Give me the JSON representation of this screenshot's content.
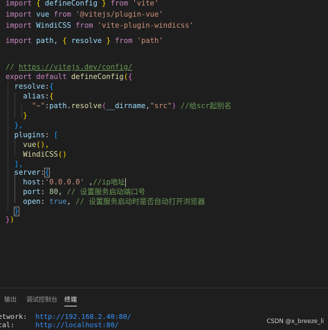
{
  "code": {
    "l1": {
      "kw1": "import",
      "b1": "{",
      "name": "defineConfig",
      "b2": "}",
      "kw2": "from",
      "src": "'vite'"
    },
    "l2": {
      "kw1": "import",
      "name": "vue",
      "kw2": "from",
      "src": "'@vitejs/plugin-vue'"
    },
    "l3": {
      "kw1": "import",
      "name": "WindiCSS",
      "kw2": "from",
      "src": "'vite-plugin-windicss'"
    },
    "l4": {
      "kw1": "import",
      "name": "path,",
      "b1": "{",
      "name2": "resolve",
      "b2": "}",
      "kw2": "from",
      "src": "'path'"
    },
    "l5": {
      "prefix": "// ",
      "url": "https://vitejs.dev/config/"
    },
    "l6": {
      "kw1": "export",
      "kw2": "default",
      "fn": "defineConfig",
      "p": "(",
      "b": "{"
    },
    "l7": {
      "key": "resolve",
      "colon": ":",
      "b": "{"
    },
    "l8": {
      "key": "alias",
      "colon": ":",
      "b": "{"
    },
    "l9": {
      "str": "\"~\"",
      "colon": ":",
      "obj": "path",
      "dot": ".",
      "fn": "resolve",
      "p1": "(",
      "arg1": "__dirname",
      "comma": ",",
      "arg2": "\"src\"",
      "p2": ")",
      "cmt": " //给scr起别名"
    },
    "l10": {
      "b": "}"
    },
    "l11": {
      "b": "},"
    },
    "l12": {
      "key": "plugins",
      "colon": ":",
      "b": "["
    },
    "l13": {
      "fn": "vue",
      "p": "(),"
    },
    "l14": {
      "fn": "WindiCSS",
      "p": "()"
    },
    "l15": {
      "b": "],"
    },
    "l16": {
      "key": "server",
      "colon": ":",
      "b": "{"
    },
    "l17": {
      "key": "host",
      "colon": ":",
      "str": "'0.0.0.0'",
      "comma": " ,",
      "cmt": "//ip地址"
    },
    "l18": {
      "key": "port",
      "colon": ":",
      "num": " 80",
      "comma": ",",
      "cmt": " // 设置服务启动端口号"
    },
    "l19": {
      "key": "open",
      "colon": ":",
      "val": " true",
      "comma": ",",
      "cmt": " // 设置服务启动时是否自动打开浏览器"
    },
    "l20": {
      "b": "}"
    },
    "l21": {
      "b": "}",
      "p": ")"
    }
  },
  "panel": {
    "tabs": [
      "输出",
      "调试控制台",
      "终端"
    ],
    "active_tab": "终端",
    "terminal": [
      {
        "label": "etwork:",
        "url": "http://192.168.2.40:80/"
      },
      {
        "label": "cal:",
        "url": "http://localhost:80/"
      }
    ]
  },
  "watermark": "CSDN @x_breeze_li"
}
